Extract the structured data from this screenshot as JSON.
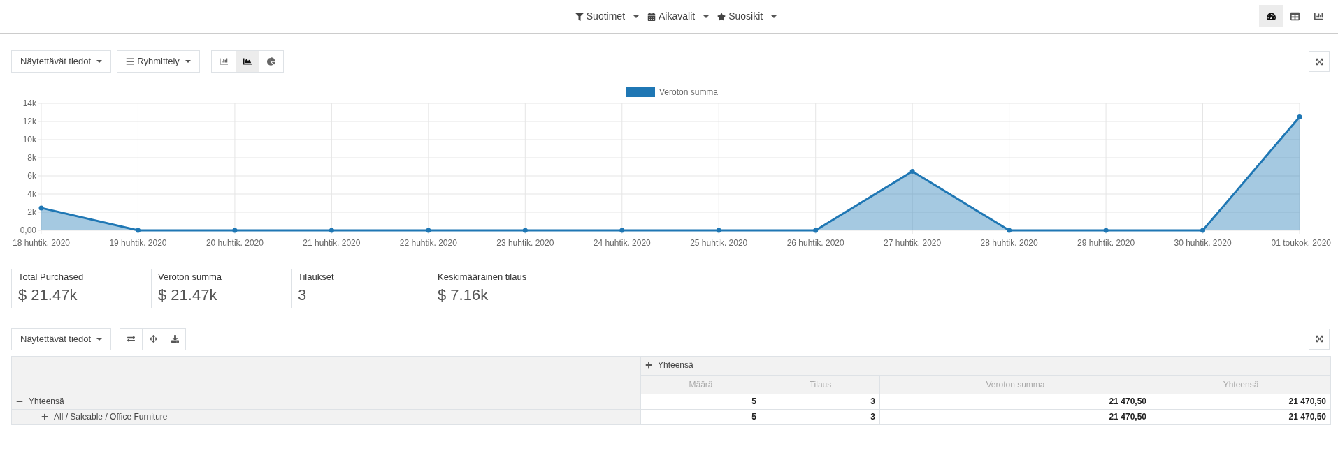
{
  "control_panel": {
    "filters": [
      {
        "kind": "filter",
        "label": "Suotimet"
      },
      {
        "kind": "calendar",
        "label": "Aikavälit"
      },
      {
        "kind": "star",
        "label": "Suosikit"
      }
    ],
    "views": [
      {
        "kind": "dashboard",
        "selected": true
      },
      {
        "kind": "pivot",
        "selected": false
      },
      {
        "kind": "graph",
        "selected": false
      }
    ]
  },
  "graph": {
    "measures_button": "Näytettävät tiedot",
    "groupby_button": "Ryhmittely",
    "chart_types": [
      {
        "kind": "bar",
        "selected": false
      },
      {
        "kind": "line",
        "selected": true
      },
      {
        "kind": "pie",
        "selected": false
      }
    ],
    "chart_data": {
      "type": "area",
      "grid": true,
      "categories": [
        "18 huhtik. 2020",
        "19 huhtik. 2020",
        "20 huhtik. 2020",
        "21 huhtik. 2020",
        "22 huhtik. 2020",
        "23 huhtik. 2020",
        "24 huhtik. 2020",
        "25 huhtik. 2020",
        "26 huhtik. 2020",
        "27 huhtik. 2020",
        "28 huhtik. 2020",
        "29 huhtik. 2020",
        "30 huhtik. 2020",
        "01 toukok. 2020"
      ],
      "series": [
        {
          "name": "Veroton summa",
          "color": "#1f77b4",
          "values": [
            2470,
            0,
            0,
            0,
            0,
            0,
            0,
            0,
            0,
            6500,
            0,
            0,
            0,
            12500
          ]
        }
      ],
      "ylim": [
        0,
        14000
      ],
      "yticks": [
        {
          "value": 0,
          "label": "0,00"
        },
        {
          "value": 2000,
          "label": "2k"
        },
        {
          "value": 4000,
          "label": "4k"
        },
        {
          "value": 6000,
          "label": "6k"
        },
        {
          "value": 8000,
          "label": "8k"
        },
        {
          "value": 10000,
          "label": "10k"
        },
        {
          "value": 12000,
          "label": "12k"
        },
        {
          "value": 14000,
          "label": "14k"
        }
      ]
    }
  },
  "kpis": [
    {
      "label": "Total Purchased",
      "value": "$ 21.47k"
    },
    {
      "label": "Veroton summa",
      "value": "$ 21.47k"
    },
    {
      "label": "Tilaukset",
      "value": "3"
    },
    {
      "label": "Keskimääräinen tilaus",
      "value": "$ 7.16k"
    }
  ],
  "pivot": {
    "measures_button": "Näytettävät tiedot",
    "column_header": {
      "label": "Yhteensä",
      "expanded": false
    },
    "measures": [
      "Määrä",
      "Tilaus",
      "Veroton summa",
      "Yhteensä"
    ],
    "rows": [
      {
        "label": "Yhteensä",
        "expanded": true,
        "values": [
          "5",
          "3",
          "21 470,50",
          "21 470,50"
        ],
        "children": [
          {
            "label": "All / Saleable / Office Furniture",
            "expanded": false,
            "values": [
              "5",
              "3",
              "21 470,50",
              "21 470,50"
            ]
          }
        ]
      }
    ]
  }
}
